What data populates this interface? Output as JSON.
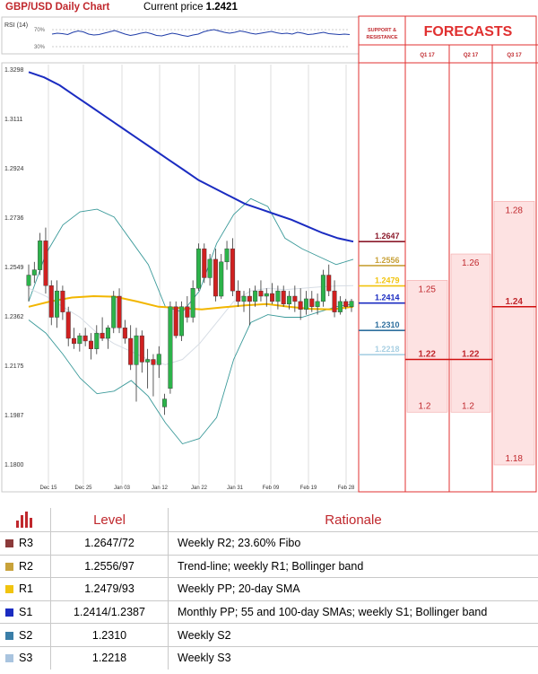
{
  "header": {
    "title": "GBP/USD Daily Chart",
    "price_label": "Current price",
    "price_value": "1.2421"
  },
  "rsi": {
    "label": "RSI (14)",
    "levels": [
      "70%",
      "30%"
    ],
    "values": [
      58,
      60,
      59,
      57,
      62,
      65,
      63,
      58,
      56,
      57,
      60,
      63,
      66,
      62,
      58,
      55,
      57,
      60,
      62,
      59,
      55,
      54,
      57,
      60,
      58,
      55,
      53,
      56,
      58,
      63,
      66,
      68,
      65,
      62,
      60,
      62,
      65,
      63,
      60,
      58,
      60,
      62,
      64,
      61,
      59,
      60,
      58,
      62,
      60,
      57,
      58,
      60,
      62,
      59,
      58,
      57,
      58,
      57
    ]
  },
  "chart_data": {
    "type": "candlestick",
    "yticks": [
      "1.3298",
      "1.3111",
      "1.2924",
      "1.2736",
      "1.2549",
      "1.2362",
      "1.2175",
      "1.1987",
      "1.1800"
    ],
    "ylim": [
      1.18,
      1.3298
    ],
    "xticks": [
      "Dec 15",
      "Dec 25",
      "Jan 03",
      "Jan 12",
      "Jan 22",
      "Jan 31",
      "Feb 09",
      "Feb 19",
      "Feb 28"
    ],
    "candles": [
      {
        "o": 1.248,
        "h": 1.256,
        "l": 1.242,
        "c": 1.252
      },
      {
        "o": 1.252,
        "h": 1.257,
        "l": 1.249,
        "c": 1.254
      },
      {
        "o": 1.254,
        "h": 1.268,
        "l": 1.252,
        "c": 1.265
      },
      {
        "o": 1.265,
        "h": 1.27,
        "l": 1.245,
        "c": 1.248
      },
      {
        "o": 1.248,
        "h": 1.25,
        "l": 1.233,
        "c": 1.236
      },
      {
        "o": 1.236,
        "h": 1.25,
        "l": 1.232,
        "c": 1.246
      },
      {
        "o": 1.246,
        "h": 1.248,
        "l": 1.235,
        "c": 1.238
      },
      {
        "o": 1.238,
        "h": 1.24,
        "l": 1.225,
        "c": 1.228
      },
      {
        "o": 1.228,
        "h": 1.232,
        "l": 1.224,
        "c": 1.226
      },
      {
        "o": 1.226,
        "h": 1.23,
        "l": 1.223,
        "c": 1.229
      },
      {
        "o": 1.229,
        "h": 1.232,
        "l": 1.225,
        "c": 1.227
      },
      {
        "o": 1.227,
        "h": 1.23,
        "l": 1.22,
        "c": 1.224
      },
      {
        "o": 1.224,
        "h": 1.233,
        "l": 1.222,
        "c": 1.23
      },
      {
        "o": 1.23,
        "h": 1.236,
        "l": 1.227,
        "c": 1.228
      },
      {
        "o": 1.228,
        "h": 1.233,
        "l": 1.224,
        "c": 1.232
      },
      {
        "o": 1.232,
        "h": 1.246,
        "l": 1.23,
        "c": 1.244
      },
      {
        "o": 1.244,
        "h": 1.247,
        "l": 1.23,
        "c": 1.232
      },
      {
        "o": 1.232,
        "h": 1.235,
        "l": 1.226,
        "c": 1.228
      },
      {
        "o": 1.228,
        "h": 1.233,
        "l": 1.216,
        "c": 1.218
      },
      {
        "o": 1.218,
        "h": 1.232,
        "l": 1.204,
        "c": 1.229
      },
      {
        "o": 1.229,
        "h": 1.231,
        "l": 1.215,
        "c": 1.219
      },
      {
        "o": 1.219,
        "h": 1.224,
        "l": 1.209,
        "c": 1.22
      },
      {
        "o": 1.22,
        "h": 1.222,
        "l": 1.206,
        "c": 1.218
      },
      {
        "o": 1.218,
        "h": 1.225,
        "l": 1.213,
        "c": 1.222
      },
      {
        "o": 1.202,
        "h": 1.207,
        "l": 1.199,
        "c": 1.205
      },
      {
        "o": 1.209,
        "h": 1.242,
        "l": 1.207,
        "c": 1.24
      },
      {
        "o": 1.24,
        "h": 1.242,
        "l": 1.228,
        "c": 1.229
      },
      {
        "o": 1.229,
        "h": 1.242,
        "l": 1.227,
        "c": 1.24
      },
      {
        "o": 1.24,
        "h": 1.244,
        "l": 1.234,
        "c": 1.236
      },
      {
        "o": 1.236,
        "h": 1.25,
        "l": 1.234,
        "c": 1.247
      },
      {
        "o": 1.247,
        "h": 1.264,
        "l": 1.246,
        "c": 1.262
      },
      {
        "o": 1.262,
        "h": 1.264,
        "l": 1.249,
        "c": 1.251
      },
      {
        "o": 1.251,
        "h": 1.26,
        "l": 1.248,
        "c": 1.258
      },
      {
        "o": 1.258,
        "h": 1.262,
        "l": 1.242,
        "c": 1.244
      },
      {
        "o": 1.244,
        "h": 1.26,
        "l": 1.243,
        "c": 1.257
      },
      {
        "o": 1.257,
        "h": 1.265,
        "l": 1.254,
        "c": 1.262
      },
      {
        "o": 1.262,
        "h": 1.266,
        "l": 1.244,
        "c": 1.246
      },
      {
        "o": 1.246,
        "h": 1.25,
        "l": 1.24,
        "c": 1.242
      },
      {
        "o": 1.242,
        "h": 1.246,
        "l": 1.238,
        "c": 1.244
      },
      {
        "o": 1.244,
        "h": 1.247,
        "l": 1.233,
        "c": 1.242
      },
      {
        "o": 1.242,
        "h": 1.248,
        "l": 1.24,
        "c": 1.246
      },
      {
        "o": 1.246,
        "h": 1.25,
        "l": 1.242,
        "c": 1.244
      },
      {
        "o": 1.244,
        "h": 1.247,
        "l": 1.24,
        "c": 1.245
      },
      {
        "o": 1.245,
        "h": 1.249,
        "l": 1.241,
        "c": 1.242
      },
      {
        "o": 1.242,
        "h": 1.248,
        "l": 1.239,
        "c": 1.246
      },
      {
        "o": 1.246,
        "h": 1.248,
        "l": 1.24,
        "c": 1.241
      },
      {
        "o": 1.241,
        "h": 1.246,
        "l": 1.239,
        "c": 1.244
      },
      {
        "o": 1.244,
        "h": 1.248,
        "l": 1.238,
        "c": 1.242
      },
      {
        "o": 1.242,
        "h": 1.247,
        "l": 1.235,
        "c": 1.239
      },
      {
        "o": 1.239,
        "h": 1.246,
        "l": 1.237,
        "c": 1.243
      },
      {
        "o": 1.243,
        "h": 1.246,
        "l": 1.238,
        "c": 1.24
      },
      {
        "o": 1.24,
        "h": 1.245,
        "l": 1.237,
        "c": 1.242
      },
      {
        "o": 1.242,
        "h": 1.254,
        "l": 1.24,
        "c": 1.252
      },
      {
        "o": 1.252,
        "h": 1.256,
        "l": 1.244,
        "c": 1.246
      },
      {
        "o": 1.246,
        "h": 1.25,
        "l": 1.236,
        "c": 1.238
      },
      {
        "o": 1.238,
        "h": 1.244,
        "l": 1.237,
        "c": 1.242
      },
      {
        "o": 1.242,
        "h": 1.243,
        "l": 1.239,
        "c": 1.24
      },
      {
        "o": 1.24,
        "h": 1.243,
        "l": 1.238,
        "c": 1.2421
      }
    ],
    "sma200": [
      1.329,
      1.327,
      1.324,
      1.32,
      1.316,
      1.312,
      1.308,
      1.304,
      1.3,
      1.296,
      1.292,
      1.288,
      1.285,
      1.282,
      1.279,
      1.277,
      1.275,
      1.273,
      1.2705,
      1.268,
      1.266,
      1.2647
    ],
    "sma55": [
      1.24,
      1.242,
      1.2435,
      1.244,
      1.2438,
      1.242,
      1.24,
      1.2395,
      1.239,
      1.2398,
      1.2405,
      1.241,
      1.24,
      1.2392,
      1.239,
      1.24
    ],
    "bb_upper": [
      1.242,
      1.26,
      1.271,
      1.276,
      1.277,
      1.274,
      1.265,
      1.256,
      1.24,
      1.238,
      1.246,
      1.264,
      1.275,
      1.281,
      1.278,
      1.266,
      1.262,
      1.259,
      1.256,
      1.258
    ],
    "bb_lower": [
      1.235,
      1.23,
      1.222,
      1.213,
      1.207,
      1.208,
      1.212,
      1.206,
      1.196,
      1.188,
      1.19,
      1.198,
      1.22,
      1.234,
      1.237,
      1.236,
      1.236,
      1.238,
      1.24,
      1.241
    ],
    "sma20": [
      1.247,
      1.244,
      1.24,
      1.236,
      1.23,
      1.226,
      1.223,
      1.22,
      1.218,
      1.22,
      1.226,
      1.234,
      1.242,
      1.246,
      1.247,
      1.2465,
      1.247,
      1.2475,
      1.2479,
      1.248
    ]
  },
  "sr": {
    "header": [
      "SUPPORT &",
      "RESISTANCE"
    ],
    "levels": [
      {
        "label": "1.2647",
        "value": 1.2647,
        "color": "#8b1a2b"
      },
      {
        "label": "1.2556",
        "value": 1.2556,
        "color": "#c8a23a"
      },
      {
        "label": "1.2479",
        "value": 1.2479,
        "color": "#f1c40f"
      },
      {
        "label": "1.2414",
        "value": 1.2414,
        "color": "#1b2cc1"
      },
      {
        "label": "1.2310",
        "value": 1.231,
        "color": "#2e6f9e"
      },
      {
        "label": "1.2218",
        "value": 1.2218,
        "color": "#a9d0e3"
      }
    ]
  },
  "forecasts": {
    "title": "FORECASTS",
    "columns": [
      {
        "label": "Q1 17",
        "high": "1.25",
        "high_value": 1.25,
        "mid": "1.22",
        "mid_value": 1.22,
        "low": "1.2",
        "low_value": 1.2
      },
      {
        "label": "Q2 17",
        "high": "1.26",
        "high_value": 1.26,
        "mid": "1.22",
        "mid_value": 1.22,
        "low": "1.2",
        "low_value": 1.2
      },
      {
        "label": "Q3 17",
        "high": "1.28",
        "high_value": 1.28,
        "mid": "1.24",
        "mid_value": 1.24,
        "low": "1.18",
        "low_value": 1.18
      }
    ]
  },
  "table": {
    "headers": [
      "Level",
      "Rationale"
    ],
    "rows": [
      {
        "name": "R3",
        "color": "#8b3a3a",
        "level": "1.2647/72",
        "rationale": "Weekly R2; 23.60% Fibo"
      },
      {
        "name": "R2",
        "color": "#c8a23a",
        "level": "1.2556/97",
        "rationale": "Trend-line; weekly R1; Bollinger band"
      },
      {
        "name": "R1",
        "color": "#f1c40f",
        "level": "1.2479/93",
        "rationale": "Weekly PP; 20-day SMA"
      },
      {
        "name": "S1",
        "color": "#1b2cc1",
        "level": "1.2414/1.2387",
        "rationale": "Monthly PP; 55 and 100-day SMAs; weekly S1; Bollinger band"
      },
      {
        "name": "S2",
        "color": "#3a7ea8",
        "level": "1.2310",
        "rationale": "Weekly S2"
      },
      {
        "name": "S3",
        "color": "#a9c4df",
        "level": "1.2218",
        "rationale": "Weekly S3"
      }
    ]
  }
}
